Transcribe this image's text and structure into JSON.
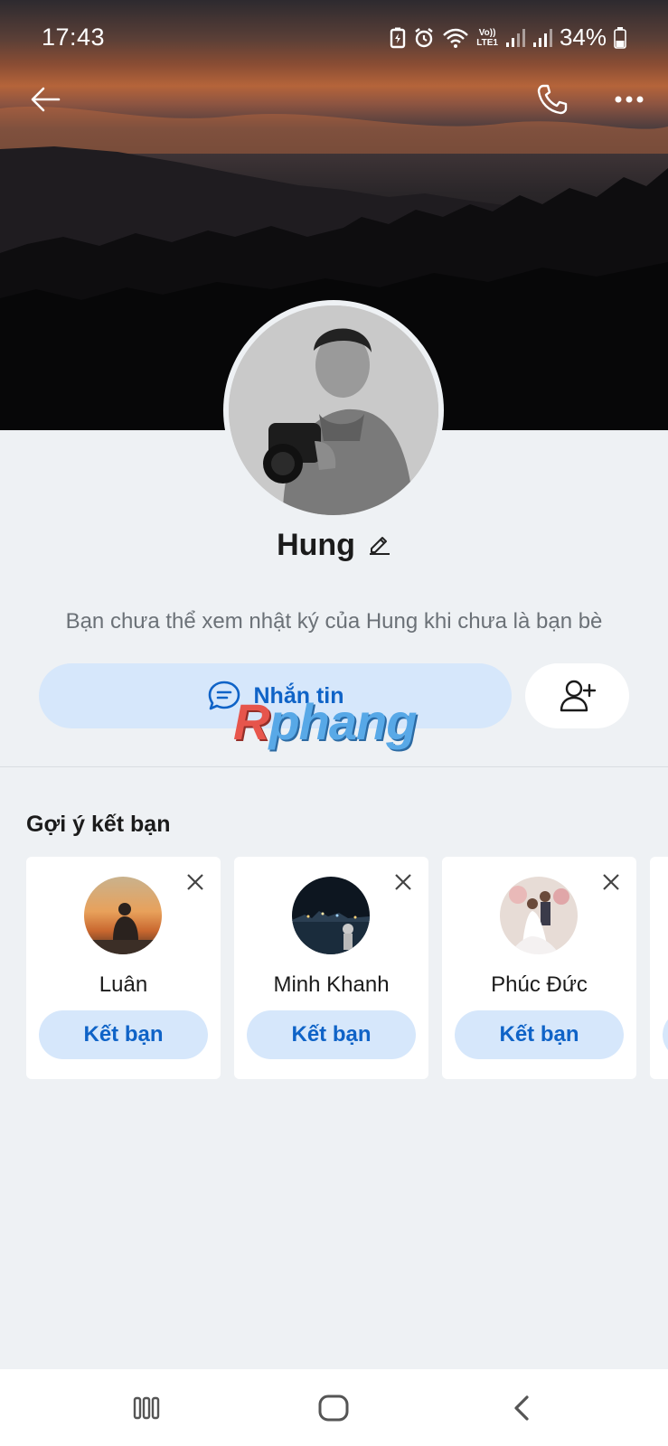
{
  "status_bar": {
    "time": "17:43",
    "battery": "34%",
    "network": "LTE1",
    "icons": [
      "battery-saver-icon",
      "alarm-icon",
      "wifi-icon",
      "volte-icon",
      "signal-icon",
      "signal-icon",
      "battery-icon"
    ]
  },
  "header": {
    "back_icon": "back-arrow-icon",
    "call_icon": "phone-icon",
    "more_icon": "more-icon"
  },
  "profile": {
    "name": "Hung",
    "diary_note": "Bạn chưa thể xem nhật ký của Hung khi chưa là bạn bè",
    "message_label": "Nhắn tin",
    "add_friend_icon": "add-friend-icon"
  },
  "watermark": {
    "first": "R",
    "rest": "phang"
  },
  "suggestions": {
    "title": "Gợi ý kết bạn",
    "items": [
      {
        "name": "Luân",
        "button": "Kết bạn"
      },
      {
        "name": "Minh Khanh",
        "button": "Kết bạn"
      },
      {
        "name": "Phúc Đức",
        "button": "Kết bạn"
      }
    ]
  },
  "nav_bar": [
    "recent-apps-icon",
    "home-icon",
    "back-icon"
  ],
  "colors": {
    "accent": "#0f63c7",
    "accent_bg": "#d6e7fb",
    "page_bg": "#eef1f4"
  }
}
